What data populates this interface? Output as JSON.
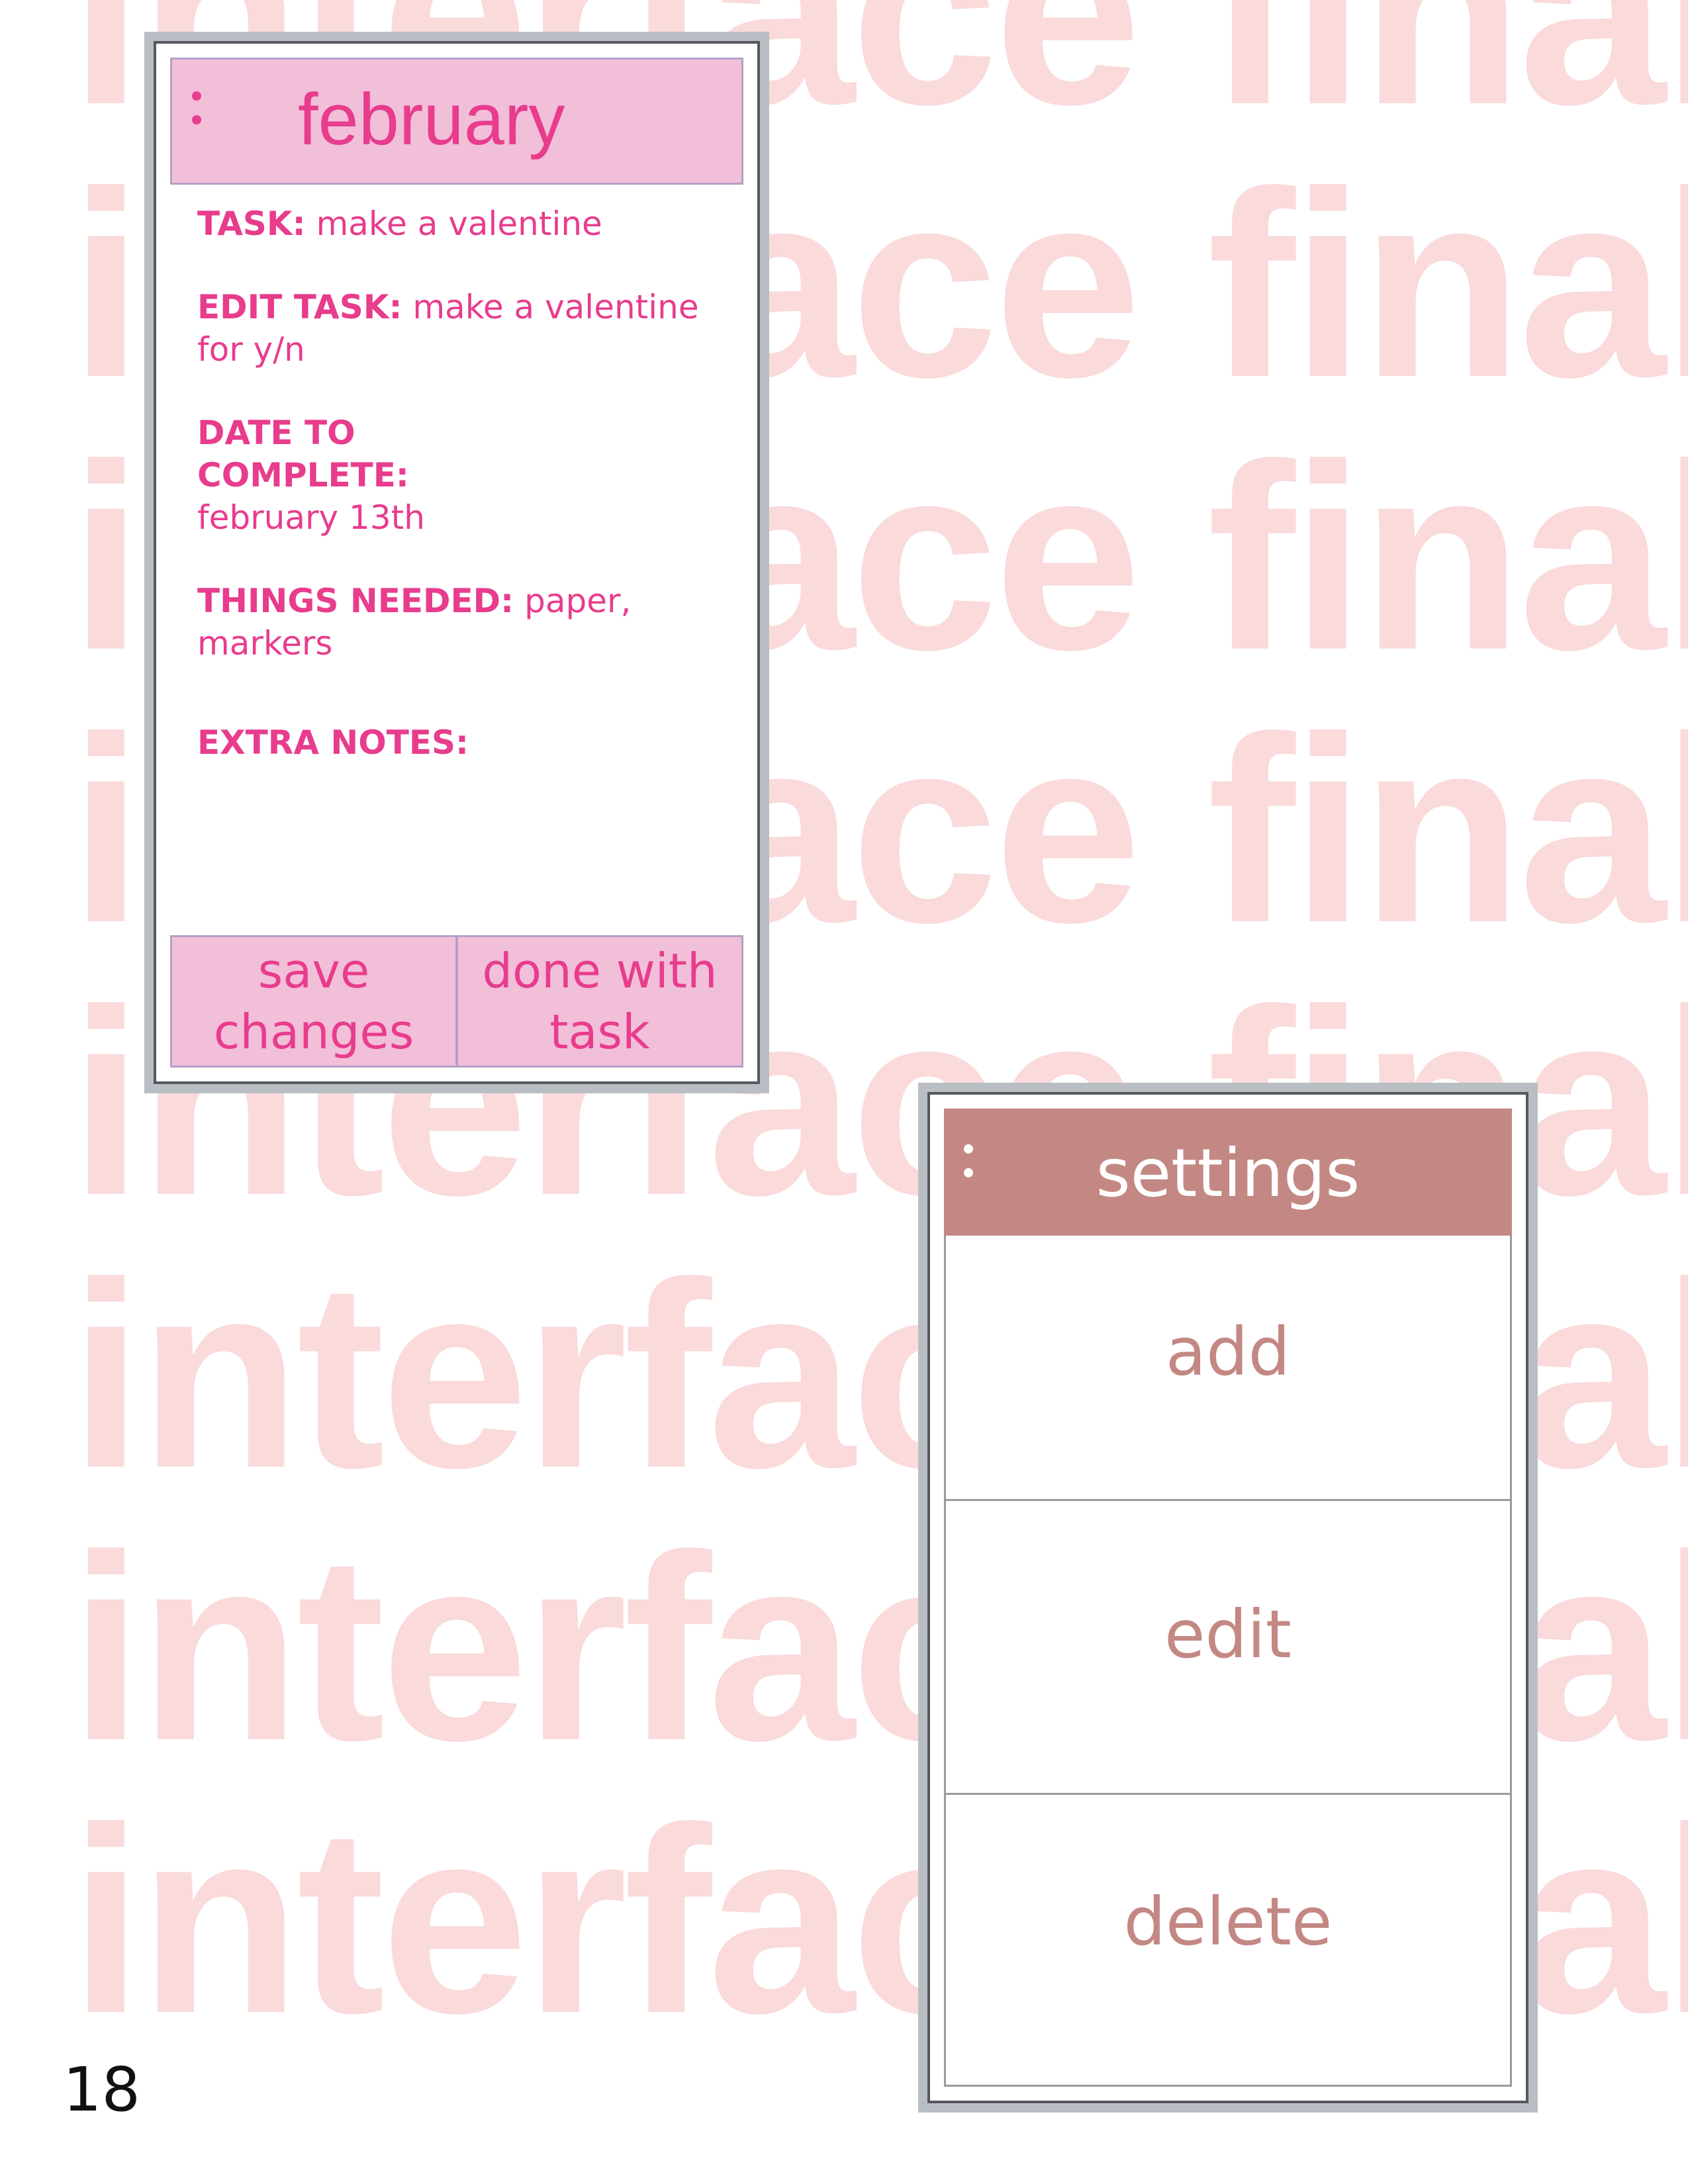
{
  "watermark": {
    "lines": [
      "interface final",
      "interface final",
      "interface final",
      "interface final",
      "interface final",
      "interface final",
      "interface final",
      "interface final"
    ]
  },
  "task_window": {
    "menu_icon": "kebab-menu-icon",
    "title": "february",
    "fields": [
      {
        "key": "TASK:",
        "value": "make a valentine"
      },
      {
        "key": "EDIT TASK:",
        "value": "make a valentine for y/n"
      },
      {
        "key": "DATE TO COMPLETE:",
        "value": "february 13th"
      },
      {
        "key": "THINGS NEEDED:",
        "value": "paper, markers"
      },
      {
        "key": "EXTRA NOTES:",
        "value": ""
      }
    ],
    "buttons": {
      "save": "save\nchanges",
      "done": "done with\ntask"
    }
  },
  "settings_window": {
    "menu_icon": "kebab-menu-icon",
    "title": "settings",
    "items": [
      "add",
      "edit",
      "delete"
    ]
  },
  "page_number": "18",
  "colors": {
    "watermark": "#fadadb",
    "task_accent": "#e83c8d",
    "task_fill": "#f2bfd9",
    "task_border": "#b3a0c6",
    "settings_accent": "#c38883",
    "frame_gray": "#b9bec4"
  }
}
